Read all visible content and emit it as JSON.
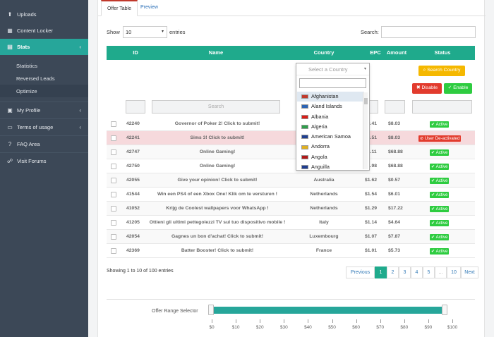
{
  "sidebar": {
    "items": [
      {
        "icon": "upload-icon",
        "label": "Uploads"
      },
      {
        "icon": "content-locker-icon",
        "label": "Content Locker"
      },
      {
        "icon": "stats-icon",
        "label": "Stats",
        "active": true
      },
      {
        "icon": "user-icon",
        "label": "My Profile"
      },
      {
        "icon": "document-icon",
        "label": "Terms of usage"
      },
      {
        "icon": "question-icon",
        "label": "FAQ Area"
      },
      {
        "icon": "forum-icon",
        "label": "Visit Forums"
      }
    ],
    "subitems": [
      "Statistics",
      "Reversed Leads",
      "Optimize"
    ]
  },
  "tabs": {
    "offer_table": "Offer Table",
    "preview": "Preview"
  },
  "controls": {
    "show_label": "Show",
    "entries_label": "entries",
    "show_value": "10",
    "search_label": "Search:"
  },
  "table": {
    "headers": [
      "ID",
      "Name",
      "Country",
      "EPC",
      "Amount",
      "Status"
    ],
    "filter_placeholder": "Search",
    "select_country": "Select a Country",
    "rows": [
      {
        "id": "42240",
        "name": "Governor of Poker 2! Click to submit!",
        "country": "",
        "epc": "$9.41",
        "amount": "$8.03",
        "status": "Active"
      },
      {
        "id": "42241",
        "name": "Sims 3! Click to submit!",
        "country": "",
        "epc": "$8.51",
        "amount": "$8.03",
        "status": "User De-activated"
      },
      {
        "id": "42747",
        "name": "Online Gaming!",
        "country": "",
        "epc": "$3.11",
        "amount": "$68.88",
        "status": "Active"
      },
      {
        "id": "42750",
        "name": "Online Gaming!",
        "country": "",
        "epc": "$1.98",
        "amount": "$68.88",
        "status": "Active"
      },
      {
        "id": "42055",
        "name": "Give your opinion! Click to submit!",
        "country": "Australia",
        "epc": "$1.62",
        "amount": "$0.57",
        "status": "Active"
      },
      {
        "id": "41544",
        "name": "Win een PS4 of een Xbox One! Klik om te versturen !",
        "country": "Netherlands",
        "epc": "$1.54",
        "amount": "$6.01",
        "status": "Active"
      },
      {
        "id": "41052",
        "name": "Krijg de Coolest wallpapers voor WhatsApp !",
        "country": "Netherlands",
        "epc": "$1.29",
        "amount": "$17.22",
        "status": "Active"
      },
      {
        "id": "41205",
        "name": "Ottieni gli ultimi pettegolezzi TV sul tuo dispositivo mobile !",
        "country": "Italy",
        "epc": "$1.14",
        "amount": "$4.64",
        "status": "Active"
      },
      {
        "id": "42054",
        "name": "Gagnes un bon d'achat! Click to submit!",
        "country": "Luxembourg",
        "epc": "$1.07",
        "amount": "$7.87",
        "status": "Active"
      },
      {
        "id": "42369",
        "name": "Batter Booster! Click to submit!",
        "country": "France",
        "epc": "$1.01",
        "amount": "$5.73",
        "status": "Active"
      }
    ]
  },
  "buttons": {
    "search_country": "Search Country",
    "disable": "Disable",
    "enable": "Enable"
  },
  "dropdown": {
    "countries": [
      {
        "name": "Afghanistan",
        "color": "#c0392b"
      },
      {
        "name": "Aland Islands",
        "color": "#2c64b3"
      },
      {
        "name": "Albania",
        "color": "#d91e18"
      },
      {
        "name": "Algeria",
        "color": "#2e9e4a"
      },
      {
        "name": "American Samoa",
        "color": "#1f3f8f"
      },
      {
        "name": "Andorra",
        "color": "#e0b020"
      },
      {
        "name": "Angola",
        "color": "#b01818"
      },
      {
        "name": "Anguilla",
        "color": "#1e3d8f"
      }
    ]
  },
  "footer": {
    "info": "Showing 1 to 10 of 100 entries",
    "pages": [
      "Previous",
      "1",
      "2",
      "3",
      "4",
      "5",
      "...",
      "10",
      "Next"
    ]
  },
  "range": {
    "label": "Offer Range Selector",
    "ticks": [
      "$0",
      "$10",
      "$20",
      "$30",
      "$40",
      "$50",
      "$60",
      "$70",
      "$80",
      "$90",
      "$100"
    ],
    "selected_min": 0,
    "selected_max": 100
  },
  "colors": {
    "accent": "#1faa8c",
    "sidebar": "#3c4857",
    "danger": "#e23b2d",
    "success": "#2ecc40",
    "warning": "#f5b800"
  }
}
